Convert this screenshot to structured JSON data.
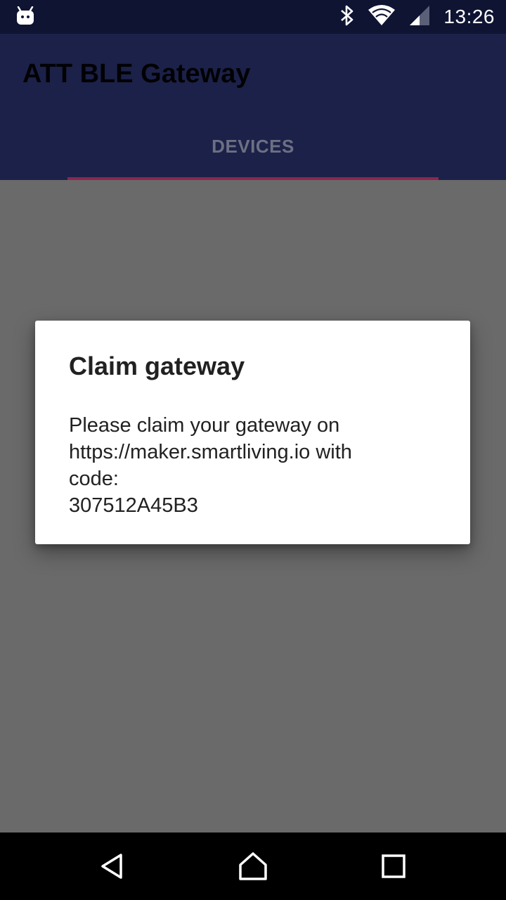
{
  "status_bar": {
    "time": "13:26",
    "icons": [
      "android-debug-icon",
      "bluetooth-icon",
      "wifi-icon",
      "cell-signal-icon"
    ]
  },
  "app_bar": {
    "title": "ATT BLE Gateway"
  },
  "tabs": [
    {
      "label": "DEVICES",
      "selected": true
    }
  ],
  "dialog": {
    "title": "Claim gateway",
    "message_lines": [
      "Please claim your gateway on",
      "https://maker.smartliving.io with",
      "code:",
      "307512A45B3"
    ]
  },
  "nav_bar": {
    "buttons": [
      "back-icon",
      "home-icon",
      "recents-icon"
    ]
  },
  "colors": {
    "status_bar": "#0f1433",
    "app_bar": "#1c2149",
    "tab_indicator": "#8d2552",
    "scrim": "#6a6a6a",
    "dialog_bg": "#ffffff"
  }
}
